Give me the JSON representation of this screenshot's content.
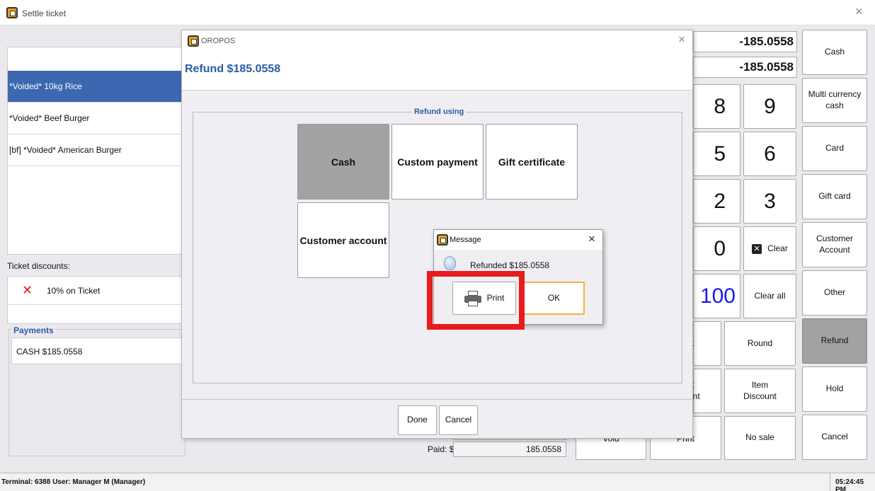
{
  "window": {
    "title": "Settle ticket"
  },
  "ticket": {
    "items": [
      {
        "label": "*Voided* 10kg Rice"
      },
      {
        "label": "*Voided* Beef Burger"
      },
      {
        "label": "[bf]  *Voided* American Burger"
      }
    ],
    "discounts_label": "Ticket discounts:",
    "discount_item": "10% on Ticket",
    "payments_label": "Payments",
    "payment_item": "CASH  $185.0558",
    "paid_label": "Paid: $",
    "paid_value": "185.0558"
  },
  "amounts": {
    "due": "-185.0558",
    "tender": "-185.0558"
  },
  "keypad": {
    "k8": "8",
    "k9": "9",
    "k5": "5",
    "k6": "6",
    "k2": "2",
    "k3": "3",
    "k0": "0",
    "clear": "Clear",
    "k100": "100",
    "clear_all": "Clear all",
    "round": "Round",
    "item_discount_1": "Item",
    "item_discount_2": "Discount",
    "no_sale": "No sale",
    "void": "Void",
    "print": "Print"
  },
  "payment_buttons": {
    "cash": "Cash",
    "multi_currency_1": "Multi currency",
    "multi_currency_2": "cash",
    "card": "Card",
    "gift_card": "Gift card",
    "customer_account_1": "Customer",
    "customer_account_2": "Account",
    "other": "Other",
    "refund": "Refund",
    "hold": "Hold",
    "cancel": "Cancel"
  },
  "dialog": {
    "title": "OROPOS",
    "heading": "Refund $185.0558",
    "group_label": "Refund using",
    "options": {
      "cash": "Cash",
      "custom_payment": "Custom payment",
      "gift_certificate": "Gift certificate",
      "customer_account": "Customer account"
    },
    "done": "Done",
    "cancel": "Cancel"
  },
  "message": {
    "title": "Message",
    "text": "Refunded $185.0558",
    "print": "Print",
    "ok": "OK"
  },
  "status": {
    "terminal": "Terminal: 6388 User: Manager M (Manager)",
    "time": "05:24:45 PM"
  },
  "colors": {
    "selected": "#3d67b1",
    "accent_text": "#2b5ca8",
    "refund_btn": "#a2a2a2",
    "highlight": "#e81c1c"
  }
}
